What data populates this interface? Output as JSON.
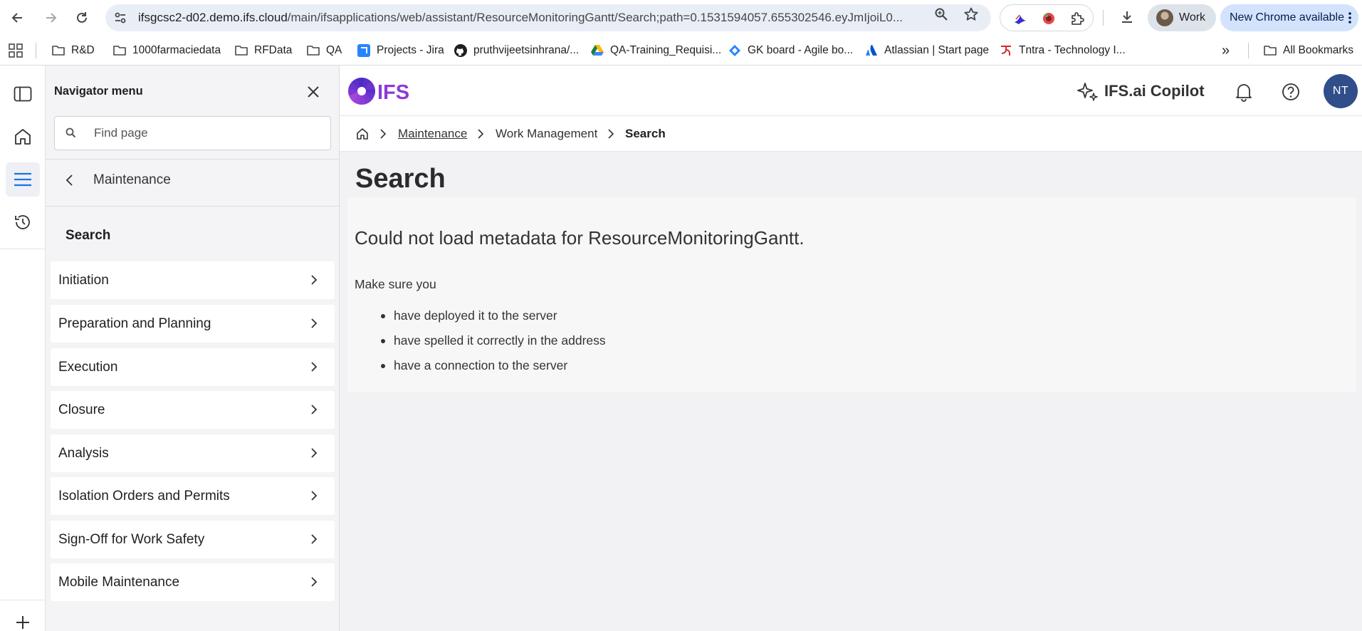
{
  "browser": {
    "url_host": "ifsgcsc2-d02.demo.ifs.cloud",
    "url_path": "/main/ifsapplications/web/assistant/ResourceMonitoringGantt/Search;path=0.1531594057.655302546.eyJmIjoiL0...",
    "profile_label": "Work",
    "update_label": "New Chrome available"
  },
  "bookmarks": {
    "items": [
      {
        "label": "R&D",
        "icon": "folder-icon"
      },
      {
        "label": "1000farmaciedata",
        "icon": "folder-icon"
      },
      {
        "label": "RFData",
        "icon": "folder-icon"
      },
      {
        "label": "QA",
        "icon": "folder-icon"
      },
      {
        "label": "Projects - Jira",
        "icon": "jira-icon"
      },
      {
        "label": "pruthvijeetsinhrana/...",
        "icon": "github-icon"
      },
      {
        "label": "QA-Training_Requisi...",
        "icon": "drive-icon"
      },
      {
        "label": "GK board - Agile bo...",
        "icon": "jira-diamond-icon"
      },
      {
        "label": "Atlassian | Start page",
        "icon": "atlassian-icon"
      },
      {
        "label": "Tntra - Technology I...",
        "icon": "tntra-icon"
      }
    ],
    "overflow_label": "»",
    "all_bookmarks_label": "All Bookmarks"
  },
  "navigator": {
    "title": "Navigator menu",
    "search_placeholder": "Find page",
    "back_label": "Maintenance",
    "section_label": "Search",
    "items": [
      {
        "label": "Initiation"
      },
      {
        "label": "Preparation and Planning"
      },
      {
        "label": "Execution"
      },
      {
        "label": "Closure"
      },
      {
        "label": "Analysis"
      },
      {
        "label": "Isolation Orders and Permits"
      },
      {
        "label": "Sign-Off for Work Safety"
      },
      {
        "label": "Mobile Maintenance"
      }
    ]
  },
  "header": {
    "logo_text": "IFS",
    "copilot_label": "IFS.ai Copilot",
    "avatar_initials": "NT"
  },
  "breadcrumb": {
    "items": [
      {
        "label": "Maintenance"
      },
      {
        "label": "Work Management"
      },
      {
        "label": "Search"
      }
    ]
  },
  "page": {
    "title": "Search",
    "error_title": "Could not load metadata for ResourceMonitoringGantt.",
    "error_text": "Make sure you",
    "error_items": [
      "have deployed it to the server",
      "have spelled it correctly in the address",
      "have a connection to the server"
    ]
  },
  "colors": {
    "accent": "#1a73e8",
    "ifs_purple": "#8d3ad6",
    "avatar": "#2f4e8a"
  }
}
